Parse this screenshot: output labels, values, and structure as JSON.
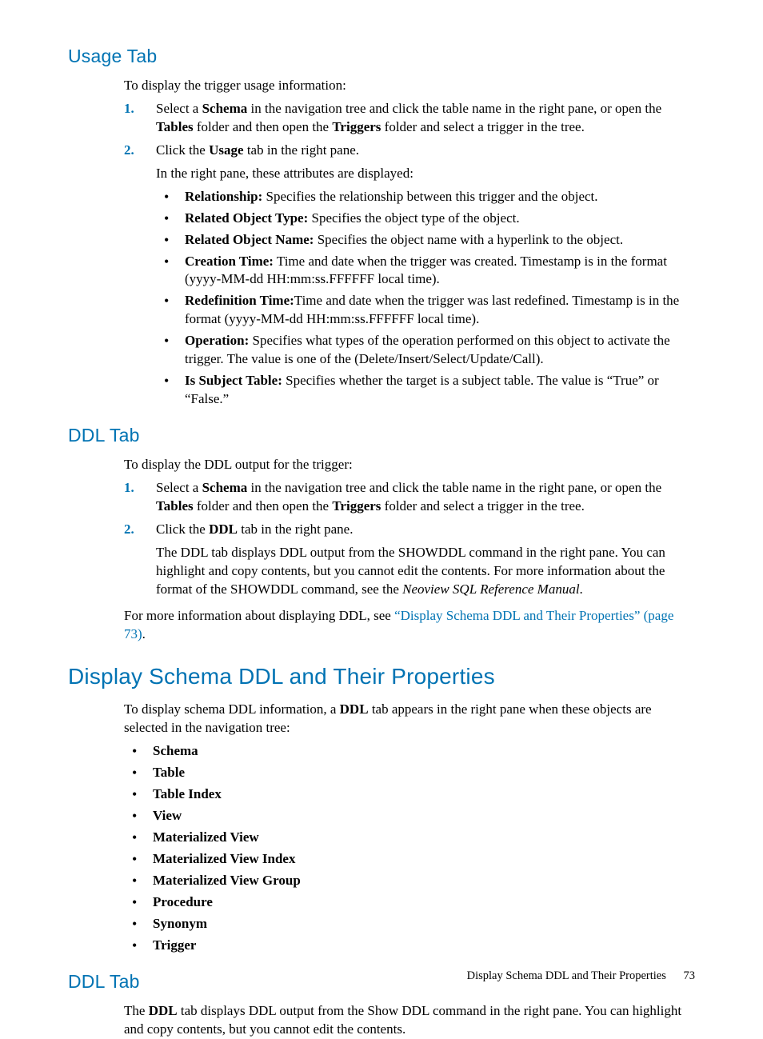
{
  "s1": {
    "heading": "Usage Tab",
    "intro": "To display the trigger usage information:",
    "step1_num": "1.",
    "step1_a": "Select a ",
    "step1_b": "Schema",
    "step1_c": " in the navigation tree and click the table name in the right pane, or open the ",
    "step1_d": "Tables",
    "step1_e": " folder and then open the ",
    "step1_f": "Triggers",
    "step1_g": " folder and select a trigger in the tree.",
    "step2_num": "2.",
    "step2_a": "Click the ",
    "step2_b": "Usage",
    "step2_c": " tab in the right pane.",
    "step2_p2": "In the right pane, these attributes are displayed:",
    "b1_a": "Relationship:",
    "b1_b": " Specifies the relationship between this trigger and the object.",
    "b2_a": "Related Object Type:",
    "b2_b": " Specifies the object type of the object.",
    "b3_a": "Related Object Name:",
    "b3_b": " Specifies the object name with a hyperlink to the object.",
    "b4_a": "Creation Time:",
    "b4_b": " Time and date when the trigger was created. Timestamp is in the format (yyyy-MM-dd HH:mm:ss.FFFFFF local time).",
    "b5_a": "Redefinition Time:",
    "b5_b": "Time and date when the trigger was last redefined. Timestamp is in the format (yyyy-MM-dd HH:mm:ss.FFFFFF local time).",
    "b6_a": "Operation:",
    "b6_b": " Specifies what types of the operation performed on this object to activate the trigger. The value is one of the (Delete/Insert/Select/Update/Call).",
    "b7_a": "Is Subject Table:",
    "b7_b": " Specifies whether the target is a subject table. The value is “True” or “False.”"
  },
  "s2": {
    "heading": "DDL Tab",
    "intro": "To display the DDL output for the trigger:",
    "step1_num": "1.",
    "step1_a": "Select a ",
    "step1_b": "Schema",
    "step1_c": " in the navigation tree and click the table name in the right pane, or open the ",
    "step1_d": "Tables",
    "step1_e": " folder and then open the ",
    "step1_f": "Triggers",
    "step1_g": " folder and select a trigger in the tree.",
    "step2_num": "2.",
    "step2_a": "Click the ",
    "step2_b": "DDL",
    "step2_c": " tab in the right pane.",
    "step2_p2_a": "The DDL tab displays DDL output from the SHOWDDL command in the right pane. You can highlight and copy contents, but you cannot edit the contents. For more information about the format of the SHOWDDL command, see the ",
    "step2_p2_b": "Neoview SQL Reference Manual",
    "step2_p2_c": ".",
    "p_after_a": "For more information about displaying DDL, see ",
    "p_after_link": "“Display Schema DDL and Their Properties” (page 73)",
    "p_after_b": "."
  },
  "s3": {
    "heading": "Display Schema DDL and Their Properties",
    "intro_a": "To display schema DDL information, a ",
    "intro_b": "DDL",
    "intro_c": " tab appears in the right pane when these objects are selected in the navigation tree:",
    "items": {
      "i0": "Schema",
      "i1": "Table",
      "i2": "Table Index",
      "i3": "View",
      "i4": "Materialized View",
      "i5": "Materialized View Index",
      "i6": "Materialized View Group",
      "i7": "Procedure",
      "i8": "Synonym",
      "i9": "Trigger"
    }
  },
  "s4": {
    "heading": "DDL Tab",
    "p_a": "The ",
    "p_b": "DDL",
    "p_c": " tab displays DDL output from the Show DDL command in the right pane. You can highlight and copy contents, but you cannot edit the contents."
  },
  "footer": {
    "title": "Display Schema DDL and Their Properties",
    "page": "73"
  }
}
